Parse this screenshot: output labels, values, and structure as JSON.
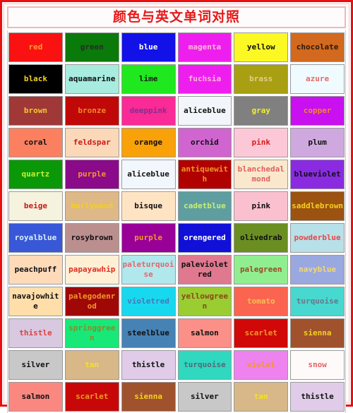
{
  "page": {
    "title": "颜色与英文单词对照",
    "frame_color": "#e81010",
    "title_text_color": "#e81818",
    "title_border_color": "#f0b8b8",
    "cell_border_color": "#9a9a9a"
  },
  "grid": {
    "columns": 6,
    "rows": 12,
    "cells": [
      {
        "label": "red",
        "bg": "#fa1212",
        "fg": "#ffa030"
      },
      {
        "label": "green",
        "bg": "#0a7a0a",
        "fg": "#2a2a2a"
      },
      {
        "label": "blue",
        "bg": "#1212e8",
        "fg": "#ffffff"
      },
      {
        "label": "magenta",
        "bg": "#ee1fee",
        "fg": "#ffb8d8"
      },
      {
        "label": "yellow",
        "bg": "#fbf824",
        "fg": "#101010"
      },
      {
        "label": "chocolate",
        "bg": "#d2691e",
        "fg": "#2a1a0a"
      },
      {
        "label": "black",
        "bg": "#000000",
        "fg": "#f5d020"
      },
      {
        "label": "aquamarine",
        "bg": "#a8ece0",
        "fg": "#101010"
      },
      {
        "label": "lime",
        "bg": "#1fe81f",
        "fg": "#1a1a1a"
      },
      {
        "label": "fuchsia",
        "bg": "#ee1fee",
        "fg": "#ffb8d8"
      },
      {
        "label": "brass",
        "bg": "#a8a012",
        "fg": "#e6cc88"
      },
      {
        "label": "azure",
        "bg": "#f0fbff",
        "fg": "#e86868"
      },
      {
        "label": "brown",
        "bg": "#a03838",
        "fg": "#f5c830"
      },
      {
        "label": "bronze",
        "bg": "#c00808",
        "fg": "#f08828"
      },
      {
        "label": "deeppink",
        "bg": "#fa2a96",
        "fg": "#803090"
      },
      {
        "label": "aliceblue",
        "bg": "#f2f6fb",
        "fg": "#101010"
      },
      {
        "label": "gray",
        "bg": "#808080",
        "fg": "#f0f028"
      },
      {
        "label": "copper",
        "bg": "#c810f0",
        "fg": "#f08828"
      },
      {
        "label": "coral",
        "bg": "#fa8060",
        "fg": "#101010"
      },
      {
        "label": "feldspar",
        "bg": "#fad8b8",
        "fg": "#d01818"
      },
      {
        "label": "orange",
        "bg": "#f9a108",
        "fg": "#101010"
      },
      {
        "label": "orchid",
        "bg": "#d065d0",
        "fg": "#101010"
      },
      {
        "label": "pink",
        "bg": "#fcc8d8",
        "fg": "#e01818"
      },
      {
        "label": "plum",
        "bg": "#d0a8e0",
        "fg": "#101010"
      },
      {
        "label": "quartz",
        "bg": "#0a9808",
        "fg": "#c8f030"
      },
      {
        "label": "purple",
        "bg": "#8a0a8a",
        "fg": "#f09828"
      },
      {
        "label": "aliceblue",
        "bg": "#f2f7fd",
        "fg": "#101010"
      },
      {
        "label": "antiquewith",
        "bg": "#b00000",
        "fg": "#f09828"
      },
      {
        "label": "blanchedalmond",
        "bg": "#fae8cc",
        "fg": "#e06060"
      },
      {
        "label": "blueviolet",
        "bg": "#8a2be2",
        "fg": "#101010"
      },
      {
        "label": "beige",
        "bg": "#f5f2dd",
        "fg": "#c81818"
      },
      {
        "label": "burlywood",
        "bg": "#deb887",
        "fg": "#f5d020"
      },
      {
        "label": "bisque",
        "bg": "#ffe4c4",
        "fg": "#101010"
      },
      {
        "label": "cadetblue",
        "bg": "#5f9ea0",
        "fg": "#c8f070"
      },
      {
        "label": "pink",
        "bg": "#fbc0d0",
        "fg": "#101010"
      },
      {
        "label": "saddlebrown",
        "bg": "#9c5210",
        "fg": "#f5d020"
      },
      {
        "label": "royalblue",
        "bg": "#3858d8",
        "fg": "#d8f0f8"
      },
      {
        "label": "rosybrown",
        "bg": "#bc8f8f",
        "fg": "#101010"
      },
      {
        "label": "purple",
        "bg": "#980098",
        "fg": "#f09828"
      },
      {
        "label": "orengered",
        "bg": "#1010d8",
        "fg": "#ffffff"
      },
      {
        "label": "olivedrab",
        "bg": "#6b8e23",
        "fg": "#101010"
      },
      {
        "label": "powderblue",
        "bg": "#b8e0e8",
        "fg": "#e84848"
      },
      {
        "label": "peachpuff",
        "bg": "#ffdab9",
        "fg": "#101010"
      },
      {
        "label": "papayawhip",
        "bg": "#ffefd5",
        "fg": "#e03020"
      },
      {
        "label": "paleturquoise",
        "bg": "#b0e8ee",
        "fg": "#e06868"
      },
      {
        "label": "palevioletred",
        "bg": "#e07890",
        "fg": "#101010"
      },
      {
        "label": "palegreen",
        "bg": "#90ee90",
        "fg": "#a04828"
      },
      {
        "label": "navyblue",
        "bg": "#9aa8e0",
        "fg": "#f5d870"
      },
      {
        "label": "navajowhite",
        "bg": "#ffdeaa",
        "fg": "#101010"
      },
      {
        "label": "palegodenrod",
        "bg": "#a00808",
        "fg": "#f09828"
      },
      {
        "label": "violetred",
        "bg": "#18d8f0",
        "fg": "#4878b8"
      },
      {
        "label": "yellowgreen",
        "bg": "#9acd32",
        "fg": "#8a4818"
      },
      {
        "label": "tomato",
        "bg": "#fa6450",
        "fg": "#f5c050"
      },
      {
        "label": "turquoise",
        "bg": "#48d8d0",
        "fg": "#687888"
      },
      {
        "label": "thistle",
        "bg": "#d8c8e0",
        "fg": "#e04040"
      },
      {
        "label": "springgreen",
        "bg": "#18e878",
        "fg": "#8a8a28"
      },
      {
        "label": "steelblue",
        "bg": "#4682b4",
        "fg": "#101010"
      },
      {
        "label": "salmon",
        "bg": "#fa9088",
        "fg": "#101010"
      },
      {
        "label": "scarlet",
        "bg": "#d00808",
        "fg": "#f09828"
      },
      {
        "label": "sienna",
        "bg": "#a0522d",
        "fg": "#f5d020"
      },
      {
        "label": "silver",
        "bg": "#c8c8c8",
        "fg": "#101010"
      },
      {
        "label": "tan",
        "bg": "#d8b888",
        "fg": "#f5e020"
      },
      {
        "label": "thistle",
        "bg": "#e0cce8",
        "fg": "#101010"
      },
      {
        "label": "turquoise",
        "bg": "#30d8c0",
        "fg": "#586878"
      },
      {
        "label": "violet",
        "bg": "#ee82ee",
        "fg": "#f09828"
      },
      {
        "label": "snow",
        "bg": "#fffafa",
        "fg": "#e86060"
      },
      {
        "label": "salmon",
        "bg": "#fa8880",
        "fg": "#101010"
      },
      {
        "label": "scarlet",
        "bg": "#c80808",
        "fg": "#f09828"
      },
      {
        "label": "sienna",
        "bg": "#a0522d",
        "fg": "#f5d020"
      },
      {
        "label": "silver",
        "bg": "#c8c8c8",
        "fg": "#101010"
      },
      {
        "label": "tan",
        "bg": "#d8b888",
        "fg": "#f5e020"
      },
      {
        "label": "thistle",
        "bg": "#e0cce8",
        "fg": "#101010"
      }
    ]
  }
}
